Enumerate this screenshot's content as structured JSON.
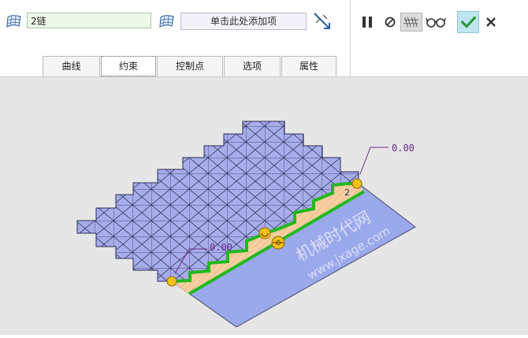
{
  "dashboard": {
    "chain_value": "2链",
    "collector_placeholder": "单击此处添加项",
    "tabs": [
      {
        "label": "曲线"
      },
      {
        "label": "约束"
      },
      {
        "label": "控制点"
      },
      {
        "label": "选项"
      },
      {
        "label": "属性"
      }
    ],
    "active_tab": "约束",
    "toolbar_icons": [
      "pause-icon",
      "stop-icon",
      "verify-preview-icon",
      "glasses-icon",
      "checkmark-icon",
      "close-icon"
    ],
    "colors": {
      "ok_bg": "#bfe5f3",
      "check": "#2e9a3a",
      "mesh_fill": "#a7acea",
      "plane_fill": "#9aa8ec",
      "constraint_green": "#22b81e",
      "vertex_yellow": "#f2c01c",
      "hatch": "#f6cfa2"
    }
  },
  "viewport": {
    "dimension_labels": [
      "0.00",
      "0.00"
    ],
    "chain_label": "2",
    "watermark_cn": "机械时代网",
    "watermark_url": "www.jxage.com"
  }
}
